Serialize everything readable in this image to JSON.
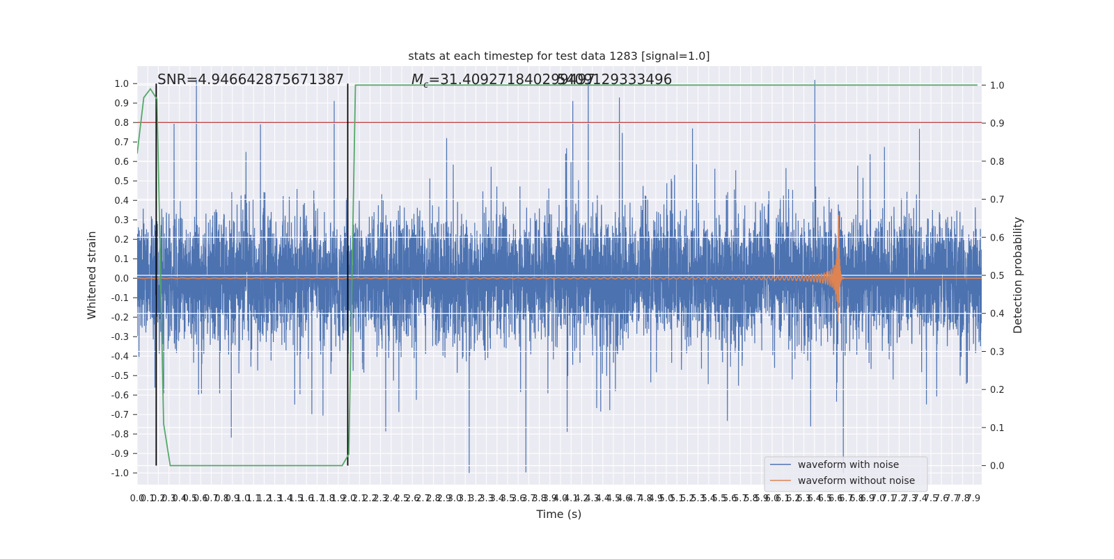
{
  "chart_data": {
    "type": "line",
    "title": "stats at each timestep for test data 1283 [signal=1.0]",
    "xlabel": "Time (s)",
    "ylabel": "Whitened strain",
    "ylabel_right": "Detection probability",
    "xlim": [
      0.0,
      7.98
    ],
    "ylim": [
      -1.06,
      1.09
    ],
    "ylim_right": [
      -0.05,
      1.05
    ],
    "xticks": [
      "0.0",
      "0.1",
      "0.2",
      "0.3",
      "0.4",
      "0.5",
      "0.6",
      "0.7",
      "0.8",
      "0.9",
      "1.0",
      "1.1",
      "1.2",
      "1.3",
      "1.4",
      "1.5",
      "1.6",
      "1.7",
      "1.8",
      "1.9",
      "2.0",
      "2.1",
      "2.2",
      "2.3",
      "2.4",
      "2.5",
      "2.6",
      "2.7",
      "2.8",
      "2.9",
      "3.0",
      "3.1",
      "3.2",
      "3.3",
      "3.4",
      "3.5",
      "3.6",
      "3.7",
      "3.8",
      "3.9",
      "4.0",
      "4.1",
      "4.2",
      "4.3",
      "4.4",
      "4.5",
      "4.6",
      "4.7",
      "4.8",
      "4.9",
      "5.0",
      "5.1",
      "5.2",
      "5.3",
      "5.4",
      "5.5",
      "5.6",
      "5.7",
      "5.8",
      "5.9",
      "6.0",
      "6.1",
      "6.2",
      "6.3",
      "6.4",
      "6.5",
      "6.6",
      "6.7",
      "6.8",
      "6.9",
      "7.0",
      "7.1",
      "7.2",
      "7.3",
      "7.4",
      "7.5",
      "7.6",
      "7.7",
      "7.8",
      "7.9"
    ],
    "yticks": [
      "-1.0",
      "-0.9",
      "-0.8",
      "-0.7",
      "-0.6",
      "-0.5",
      "-0.4",
      "-0.3",
      "-0.2",
      "-0.1",
      "0.0",
      "0.1",
      "0.2",
      "0.3",
      "0.4",
      "0.5",
      "0.6",
      "0.7",
      "0.8",
      "0.9",
      "1.0"
    ],
    "yticks_right": [
      "0.0",
      "0.1",
      "0.2",
      "0.3",
      "0.4",
      "0.5",
      "0.6",
      "0.7",
      "0.8",
      "0.9",
      "1.0"
    ],
    "grid": true,
    "legend_placement": "lower-right",
    "annotations": {
      "snr": "SNR=4.946642875671387",
      "mc_prefix": "M",
      "mc_sub": "c",
      "mc_value": "=31.409271840299497",
      "mc_overlap": "5409129333496"
    },
    "series": [
      {
        "name": "waveform with noise",
        "color": "#4c72b0",
        "kind": "noise"
      },
      {
        "name": "waveform without noise",
        "color": "#dd8452",
        "kind": "chirp",
        "merger_time": 6.63
      },
      {
        "kind": "detection_probability",
        "axis": "right",
        "color": "#55a868",
        "x": [
          0.0,
          0.0625,
          0.125,
          0.1875,
          0.25,
          0.3125,
          0.375,
          1.875,
          1.9375,
          2.0,
          2.0625,
          7.94
        ],
        "y": [
          0.82,
          0.967,
          0.99,
          0.963,
          0.11,
          0.0,
          0.0,
          0.0,
          0.0,
          0.03,
          1.0,
          1.0
        ]
      }
    ],
    "threshold_line": {
      "value": 0.8,
      "color": "#c44e52"
    },
    "vertical_markers": {
      "x": [
        0.18,
        1.99
      ],
      "color": "#000000"
    },
    "colors": {
      "background": "#eaeaf2",
      "grid": "#ffffff"
    }
  }
}
